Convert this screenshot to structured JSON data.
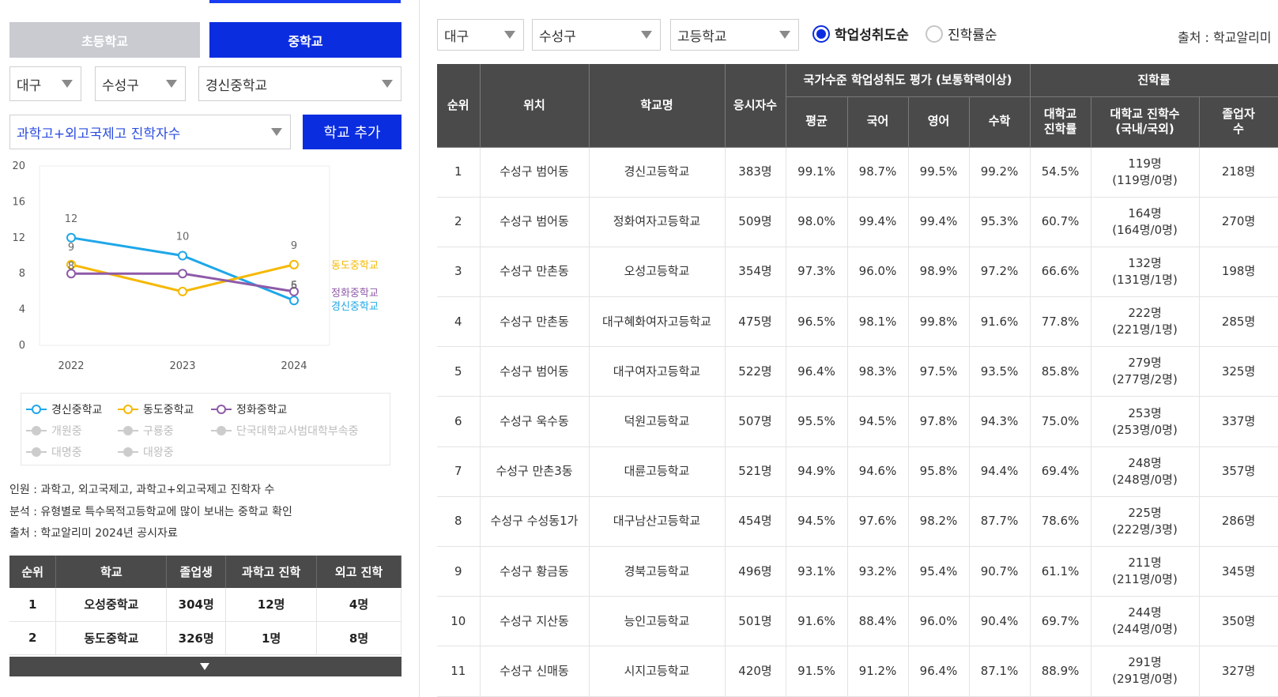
{
  "left": {
    "tabs": [
      {
        "label": "초등학교",
        "active": false
      },
      {
        "label": "중학교",
        "active": true
      }
    ],
    "region": "대구",
    "district": "수성구",
    "school": "경신중학교",
    "metric": "과학고+외고국제고 진학자수",
    "add_button": "학교 추가",
    "chart_data": {
      "type": "line",
      "x": [
        "2022",
        "2023",
        "2024"
      ],
      "ylim": [
        0,
        20
      ],
      "yticks": [
        "0",
        "4",
        "8",
        "12",
        "16",
        "20"
      ],
      "series": [
        {
          "name": "경신중학교",
          "color": "#1ea7e8",
          "values": [
            12,
            10,
            5
          ]
        },
        {
          "name": "동도중학교",
          "color": "#f5b800",
          "values": [
            9,
            6,
            9
          ]
        },
        {
          "name": "정화중학교",
          "color": "#8e5aa8",
          "values": [
            8,
            8,
            6
          ]
        }
      ],
      "point_labels": [
        {
          "series": 0,
          "index": 0,
          "text": "12"
        },
        {
          "series": 0,
          "index": 1,
          "text": "10"
        },
        {
          "series": 1,
          "index": 0,
          "text": "9"
        },
        {
          "series": 2,
          "index": 0,
          "text": "8"
        },
        {
          "series": 1,
          "index": 2,
          "text": "9"
        },
        {
          "series": 2,
          "index": 2,
          "text": "6"
        },
        {
          "series": 0,
          "index": 2,
          "text": "5"
        }
      ],
      "end_labels": [
        {
          "text": "동도중학교",
          "color": "#f5b800"
        },
        {
          "text": "정화중학교",
          "color": "#8e5aa8"
        },
        {
          "text": "경신중학교",
          "color": "#1ea7e8"
        }
      ],
      "grid": false
    },
    "legend": [
      {
        "label": "경신중학교",
        "color": "#1ea7e8",
        "active": true
      },
      {
        "label": "동도중학교",
        "color": "#f5b800",
        "active": true
      },
      {
        "label": "정화중학교",
        "color": "#8e5aa8",
        "active": true
      },
      {
        "label": "개원중",
        "color": "#cccccc",
        "active": false
      },
      {
        "label": "구룡중",
        "color": "#cccccc",
        "active": false
      },
      {
        "label": "단국대학교사범대학부속중",
        "color": "#cccccc",
        "active": false
      },
      {
        "label": "대명중",
        "color": "#cccccc",
        "active": false
      },
      {
        "label": "대왕중",
        "color": "#cccccc",
        "active": false
      }
    ],
    "notes": [
      "인원 : 과학고, 외고국제고, 과학고+외고국제고 진학자 수",
      "분석 : 유형별로 특수목적고등학교에 많이 보내는 중학교 확인",
      "출처 : 학교알리미 2024년 공시자료"
    ],
    "mini_table": {
      "headers": [
        "순위",
        "학교",
        "졸업생",
        "과학고 진학",
        "외고 진학"
      ],
      "rows": [
        [
          "1",
          "오성중학교",
          "304명",
          "12명",
          "4명"
        ],
        [
          "2",
          "동도중학교",
          "326명",
          "1명",
          "8명"
        ]
      ]
    }
  },
  "right": {
    "region": "대구",
    "district": "수성구",
    "level": "고등학교",
    "sort_options": [
      {
        "label": "학업성취도순",
        "selected": true
      },
      {
        "label": "진학률순",
        "selected": false
      }
    ],
    "source": "출처 : 학교알리미",
    "header": {
      "rank": "순위",
      "location": "위치",
      "name": "학교명",
      "takers": "응시자수",
      "group_achievement": "국가수준 학업성취도 평가 (보통학력이상)",
      "avg": "평균",
      "korean": "국어",
      "english": "영어",
      "math": "수학",
      "group_progress": "진학률",
      "univ_rate_1": "대학교",
      "univ_rate_2": "진학률",
      "univ_count_1": "대학교 진학수",
      "univ_count_2": "(국내/국외)",
      "grad_1": "졸업자",
      "grad_2": "수"
    },
    "rows": [
      {
        "rank": "1",
        "loc": "수성구 범어동",
        "name": "경신고등학교",
        "takers": "383명",
        "avg": "99.1%",
        "kor": "98.7%",
        "eng": "99.5%",
        "math": "99.2%",
        "rate": "54.5%",
        "cnt": "119명",
        "cnt2": "(119명/0명)",
        "grad": "218명"
      },
      {
        "rank": "2",
        "loc": "수성구 범어동",
        "name": "정화여자고등학교",
        "takers": "509명",
        "avg": "98.0%",
        "kor": "99.4%",
        "eng": "99.4%",
        "math": "95.3%",
        "rate": "60.7%",
        "cnt": "164명",
        "cnt2": "(164명/0명)",
        "grad": "270명"
      },
      {
        "rank": "3",
        "loc": "수성구 만촌동",
        "name": "오성고등학교",
        "takers": "354명",
        "avg": "97.3%",
        "kor": "96.0%",
        "eng": "98.9%",
        "math": "97.2%",
        "rate": "66.6%",
        "cnt": "132명",
        "cnt2": "(131명/1명)",
        "grad": "198명"
      },
      {
        "rank": "4",
        "loc": "수성구 만촌동",
        "name": "대구혜화여자고등학교",
        "takers": "475명",
        "avg": "96.5%",
        "kor": "98.1%",
        "eng": "99.8%",
        "math": "91.6%",
        "rate": "77.8%",
        "cnt": "222명",
        "cnt2": "(221명/1명)",
        "grad": "285명"
      },
      {
        "rank": "5",
        "loc": "수성구 범어동",
        "name": "대구여자고등학교",
        "takers": "522명",
        "avg": "96.4%",
        "kor": "98.3%",
        "eng": "97.5%",
        "math": "93.5%",
        "rate": "85.8%",
        "cnt": "279명",
        "cnt2": "(277명/2명)",
        "grad": "325명"
      },
      {
        "rank": "6",
        "loc": "수성구 욱수동",
        "name": "덕원고등학교",
        "takers": "507명",
        "avg": "95.5%",
        "kor": "94.5%",
        "eng": "97.8%",
        "math": "94.3%",
        "rate": "75.0%",
        "cnt": "253명",
        "cnt2": "(253명/0명)",
        "grad": "337명"
      },
      {
        "rank": "7",
        "loc": "수성구 만촌3동",
        "name": "대륜고등학교",
        "takers": "521명",
        "avg": "94.9%",
        "kor": "94.6%",
        "eng": "95.8%",
        "math": "94.4%",
        "rate": "69.4%",
        "cnt": "248명",
        "cnt2": "(248명/0명)",
        "grad": "357명"
      },
      {
        "rank": "8",
        "loc": "수성구 수성동1가",
        "name": "대구남산고등학교",
        "takers": "454명",
        "avg": "94.5%",
        "kor": "97.6%",
        "eng": "98.2%",
        "math": "87.7%",
        "rate": "78.6%",
        "cnt": "225명",
        "cnt2": "(222명/3명)",
        "grad": "286명"
      },
      {
        "rank": "9",
        "loc": "수성구 황금동",
        "name": "경북고등학교",
        "takers": "496명",
        "avg": "93.1%",
        "kor": "93.2%",
        "eng": "95.4%",
        "math": "90.7%",
        "rate": "61.1%",
        "cnt": "211명",
        "cnt2": "(211명/0명)",
        "grad": "345명"
      },
      {
        "rank": "10",
        "loc": "수성구 지산동",
        "name": "능인고등학교",
        "takers": "501명",
        "avg": "91.6%",
        "kor": "88.4%",
        "eng": "96.0%",
        "math": "90.4%",
        "rate": "69.7%",
        "cnt": "244명",
        "cnt2": "(244명/0명)",
        "grad": "350명"
      },
      {
        "rank": "11",
        "loc": "수성구 신매동",
        "name": "시지고등학교",
        "takers": "420명",
        "avg": "91.5%",
        "kor": "91.2%",
        "eng": "96.4%",
        "math": "87.1%",
        "rate": "88.9%",
        "cnt": "291명",
        "cnt2": "(291명/0명)",
        "grad": "327명"
      }
    ]
  }
}
